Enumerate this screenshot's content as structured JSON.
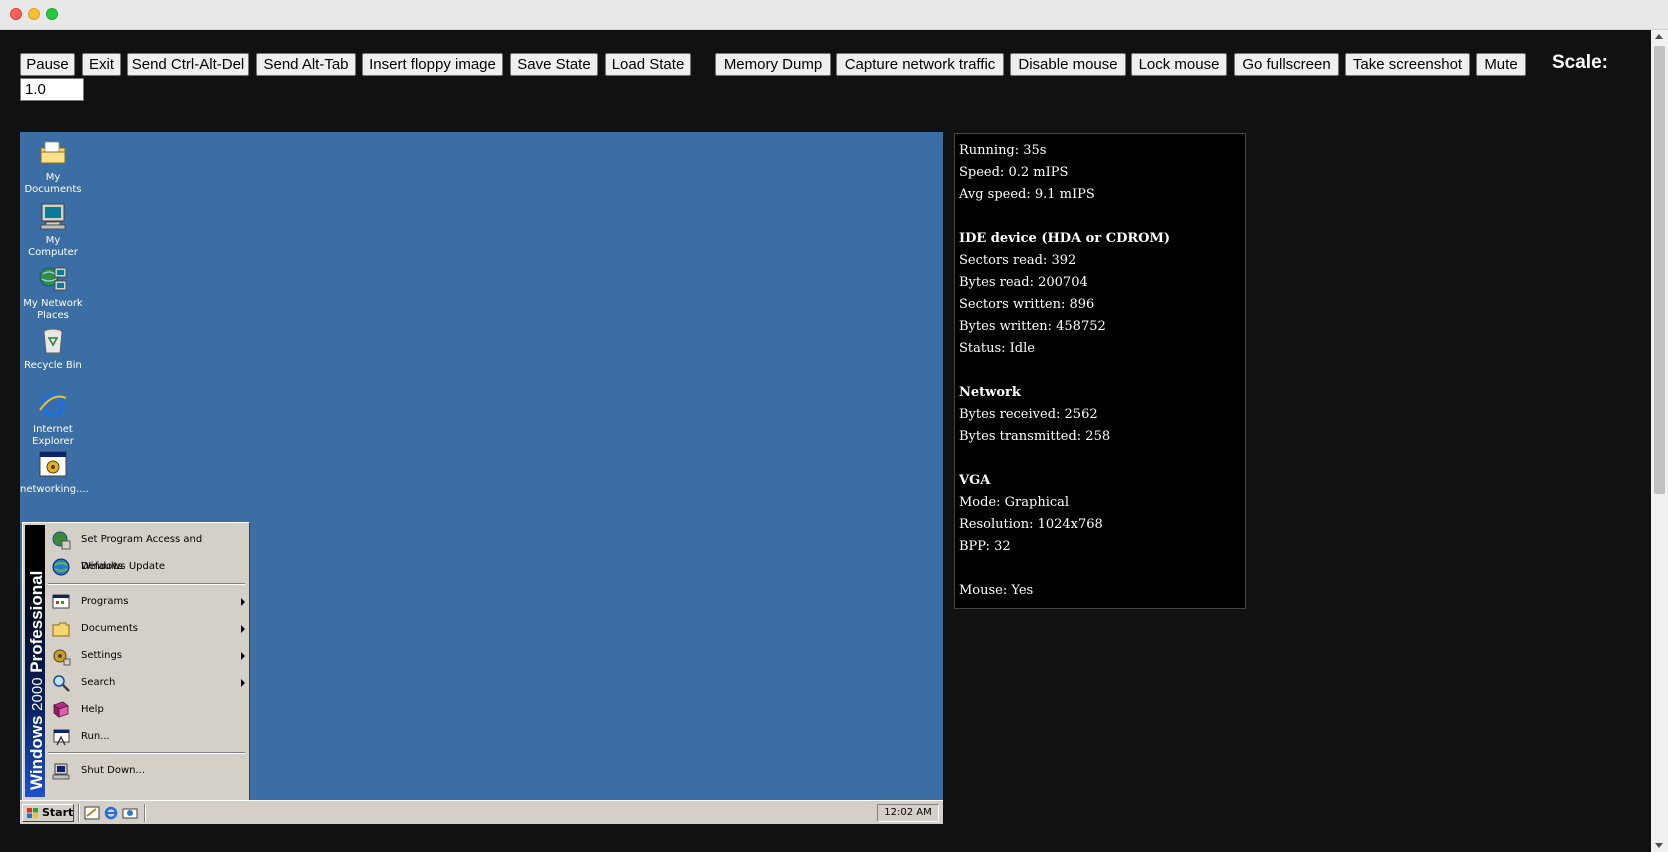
{
  "toolbar": {
    "buttons": [
      {
        "label": "Pause"
      },
      {
        "label": "Exit"
      },
      {
        "label": "Send Ctrl-Alt-Del"
      },
      {
        "label": "Send Alt-Tab"
      },
      {
        "label": "Insert floppy image"
      },
      {
        "label": "Save State"
      },
      {
        "label": "Load State"
      },
      {
        "label": "Memory Dump"
      },
      {
        "label": "Capture network traffic"
      },
      {
        "label": "Disable mouse"
      },
      {
        "label": "Lock mouse"
      },
      {
        "label": "Go fullscreen"
      },
      {
        "label": "Take screenshot"
      },
      {
        "label": "Mute"
      }
    ],
    "scale_label": "Scale:",
    "scale_value": "1.0"
  },
  "desktop": {
    "icons": [
      {
        "label": "My Documents"
      },
      {
        "label": "My Computer"
      },
      {
        "label": "My Network Places"
      },
      {
        "label": "Recycle Bin"
      },
      {
        "label": "Internet Explorer"
      },
      {
        "label": "networking...."
      }
    ],
    "background_color": "#3a6ea5"
  },
  "start_menu": {
    "banner_brand": "Windows",
    "banner_version": "2000",
    "banner_edition": "Professional",
    "items": [
      {
        "label": "Set Program Access and Defaults",
        "icon": "program-access-icon"
      },
      {
        "label": "Windows Update",
        "icon": "windows-update-icon"
      },
      {
        "label": "Programs",
        "icon": "programs-icon",
        "submenu": true
      },
      {
        "label": "Documents",
        "icon": "documents-icon",
        "submenu": true
      },
      {
        "label": "Settings",
        "icon": "settings-icon",
        "submenu": true
      },
      {
        "label": "Search",
        "icon": "search-icon",
        "submenu": true
      },
      {
        "label": "Help",
        "icon": "help-icon"
      },
      {
        "label": "Run...",
        "icon": "run-icon"
      },
      {
        "label": "Shut Down...",
        "icon": "shutdown-icon"
      }
    ]
  },
  "taskbar": {
    "start_label": "Start",
    "clock": "12:02 AM"
  },
  "stats": {
    "running": "Running: 35s",
    "speed": "Speed: 0.2 mIPS",
    "avg_speed": "Avg speed: 9.1 mIPS",
    "ide_header": "IDE device (HDA or CDROM)",
    "sectors_read": "Sectors read: 392",
    "bytes_read": "Bytes read: 200704",
    "sectors_written": "Sectors written: 896",
    "bytes_written": "Bytes written: 458752",
    "status": "Status: Idle",
    "network_header": "Network",
    "bytes_received": "Bytes received: 2562",
    "bytes_transmitted": "Bytes transmitted: 258",
    "vga_header": "VGA",
    "mode": "Mode: Graphical",
    "resolution": "Resolution: 1024x768",
    "bpp": "BPP: 32",
    "mouse": "Mouse: Yes"
  }
}
